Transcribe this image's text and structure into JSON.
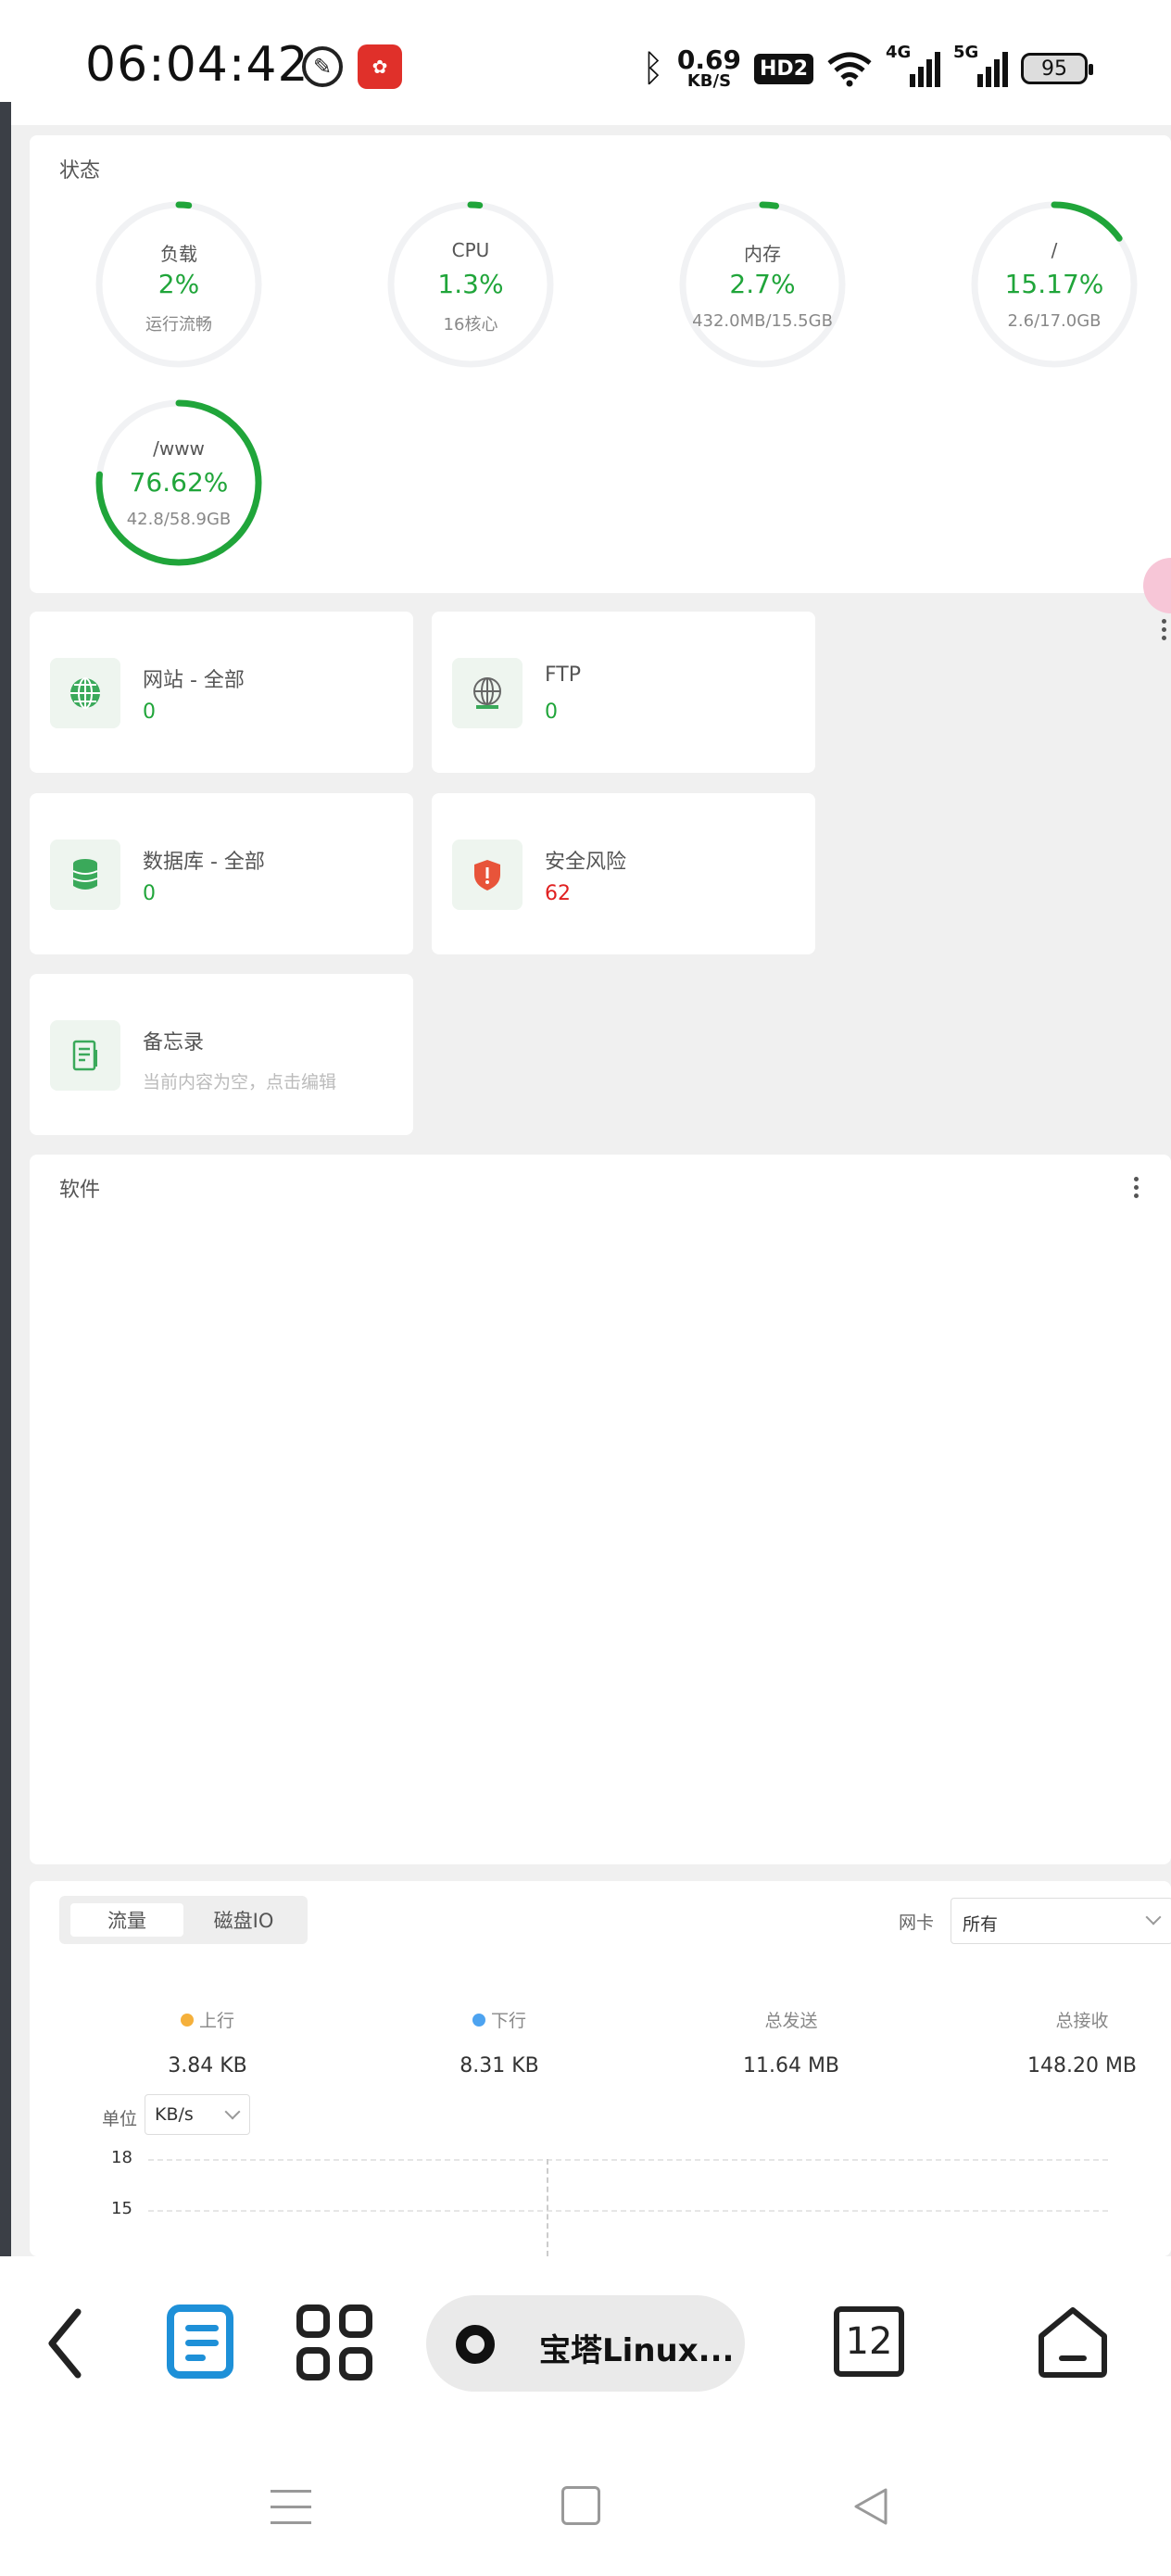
{
  "status_bar": {
    "time": "06:04:42",
    "net_speed_value": "0.69",
    "net_speed_unit": "KB/S",
    "hd_badge": "HD2",
    "sig1_label": "4G",
    "sig2_label": "5G",
    "battery": "95"
  },
  "state_card": {
    "title": "状态",
    "gauges": [
      {
        "label": "负载",
        "value": "2%",
        "sub": "运行流畅",
        "percent": 2
      },
      {
        "label": "CPU",
        "value": "1.3%",
        "sub": "16核心",
        "percent": 1.3
      },
      {
        "label": "内存",
        "value": "2.7%",
        "sub": "432.0MB/15.5GB",
        "percent": 2.7
      },
      {
        "label": "/",
        "value": "15.17%",
        "sub": "2.6/17.0GB",
        "percent": 15.17
      },
      {
        "label": "/www",
        "value": "76.62%",
        "sub": "42.8/58.9GB",
        "percent": 76.62
      }
    ]
  },
  "stats": {
    "website": {
      "label": "网站 - 全部",
      "value": "0"
    },
    "ftp": {
      "label": "FTP",
      "value": "0"
    },
    "database": {
      "label": "数据库 - 全部",
      "value": "0"
    },
    "security": {
      "label": "安全风险",
      "value": "62"
    },
    "memo": {
      "label": "备忘录",
      "note": "当前内容为空，点击编辑"
    }
  },
  "software": {
    "title": "软件"
  },
  "traffic": {
    "tabs": [
      "流量",
      "磁盘IO"
    ],
    "nic_label": "网卡",
    "nic_value": "所有",
    "upload": {
      "label": "上行",
      "value": "3.84 KB",
      "color": "#f5b03b"
    },
    "download": {
      "label": "下行",
      "value": "8.31 KB",
      "color": "#4da3f0"
    },
    "total_sent": {
      "label": "总发送",
      "value": "11.64 MB"
    },
    "total_recv": {
      "label": "总接收",
      "value": "148.20 MB"
    },
    "unit_label": "单位",
    "unit_value": "KB/s",
    "y_ticks": [
      "18",
      "15"
    ]
  },
  "browser_toolbar": {
    "tab_title": "宝塔Linux...",
    "tab_count": "12"
  },
  "colors": {
    "accent_green": "#20a53a",
    "danger_red": "#e02020",
    "toolbar_blue": "#1e90d8"
  }
}
